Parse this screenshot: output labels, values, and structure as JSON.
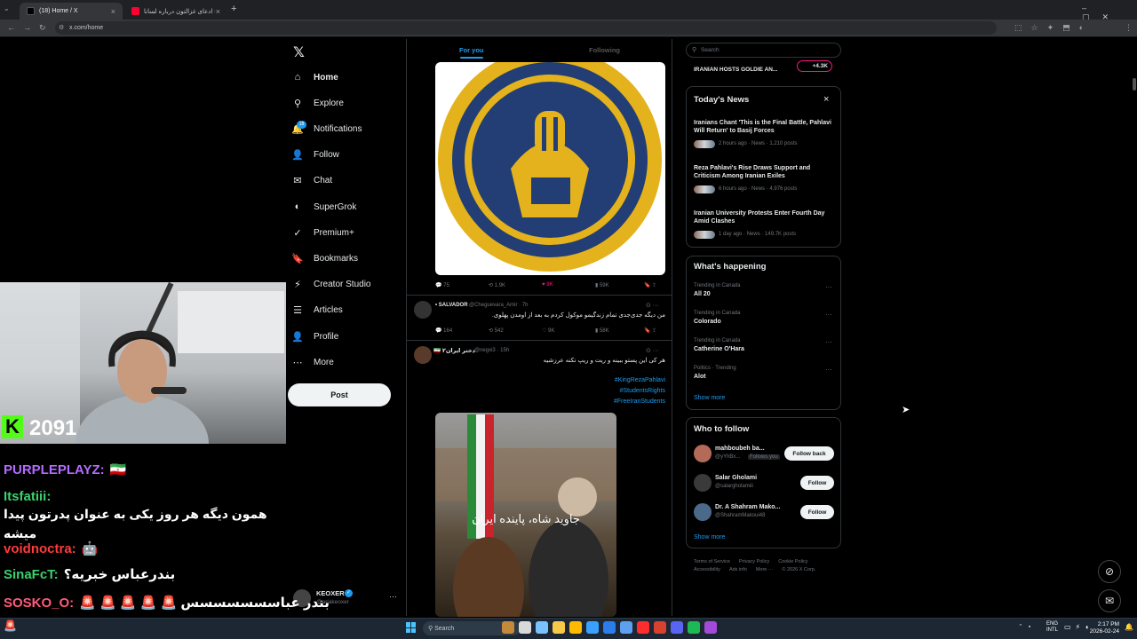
{
  "browser": {
    "tabs": [
      {
        "title": "(18) Home / X",
        "active": true
      },
      {
        "title": "ادعای غزالتون درباره لسانا (JM5)",
        "active": false
      }
    ],
    "new_tab": "+",
    "url": "x.com/home"
  },
  "sidebar": {
    "logo": "𝕏",
    "items": [
      {
        "label": "Home",
        "icon": "home-icon",
        "glyph": "⌂",
        "bold": true
      },
      {
        "label": "Explore",
        "icon": "search-icon",
        "glyph": "⚲"
      },
      {
        "label": "Notifications",
        "icon": "bell-icon",
        "glyph": "🔔",
        "badge": "18"
      },
      {
        "label": "Follow",
        "icon": "person-plus-icon",
        "glyph": "👤"
      },
      {
        "label": "Chat",
        "icon": "mail-icon",
        "glyph": "✉"
      },
      {
        "label": "SuperGrok",
        "icon": "grok-icon",
        "glyph": "◐"
      },
      {
        "label": "Premium+",
        "icon": "premium-icon",
        "glyph": "✓"
      },
      {
        "label": "Bookmarks",
        "icon": "bookmark-icon",
        "glyph": "🔖"
      },
      {
        "label": "Creator Studio",
        "icon": "creator-icon",
        "glyph": "⚡"
      },
      {
        "label": "Articles",
        "icon": "articles-icon",
        "glyph": "☰"
      },
      {
        "label": "Profile",
        "icon": "profile-icon",
        "glyph": "👤"
      },
      {
        "label": "More",
        "icon": "more-icon",
        "glyph": "⋯"
      }
    ],
    "post_button": "Post",
    "account": {
      "name": "KEOXER",
      "handle": "@ariakeoxer"
    }
  },
  "feed": {
    "tabs": [
      "For you",
      "Following"
    ],
    "tweet1_stats": {
      "replies": "75",
      "reposts": "1.9K",
      "likes": "9K",
      "views": "59K"
    },
    "tweet2": {
      "name": "• SALVADOR",
      "handle": "@Cheguevara_Amir · 7h",
      "text": "من دیگه جدی‌جدی تمام زندگیمو موکول کردم به بعد از اومدن پهلوی.",
      "stats": {
        "replies": "164",
        "reposts": "542",
        "likes": "9K",
        "views": "58K"
      }
    },
    "tweet3": {
      "name": "دختر ایران۲ 🇮🇷",
      "handle": "@negxi3 · 15h",
      "text": "هر کی این پستو ببینه و ریت و ریپ نکنه عرزشیه",
      "hashtags": [
        "#KingRezaPahlavi",
        "#StudentsRights",
        "#FreeIranStudents"
      ],
      "image_caption": "جاوید شاه، پاینده ایران"
    }
  },
  "right": {
    "search_placeholder": "Search",
    "live_banner": {
      "text": "IRANIAN HOSTS GOLDIE AN...",
      "count": "+4.3K"
    },
    "todays_news": {
      "title": "Today's News",
      "close": "×",
      "items": [
        {
          "headline": "Iranians Chant 'This is the Final Battle, Pahlavi Will Return' to Basij Forces",
          "meta": "2 hours ago · News · 1,210 posts"
        },
        {
          "headline": "Reza Pahlavi's Rise Draws Support and Criticism Among Iranian Exiles",
          "meta": "6 hours ago · News · 4,976 posts"
        },
        {
          "headline": "Iranian University Protests Enter Fourth Day Amid Clashes",
          "meta": "1 day ago · News · 149.7K posts"
        }
      ]
    },
    "whats_happening": {
      "title": "What's happening",
      "items": [
        {
          "context": "Trending in Canada",
          "name": "All 20"
        },
        {
          "context": "Trending in Canada",
          "name": "Colorado"
        },
        {
          "context": "Trending in Canada",
          "name": "Catherine O'Hara"
        },
        {
          "context": "Politics · Trending",
          "name": "Alot"
        }
      ],
      "show_more": "Show more"
    },
    "who_to_follow": {
      "title": "Who to follow",
      "items": [
        {
          "name": "mahboubeh ba...",
          "handle": "@yYhBx...",
          "follows_you": "Follows you",
          "button": "Follow back"
        },
        {
          "name": "Salar Gholami",
          "handle": "@salargholamiii",
          "button": "Follow"
        },
        {
          "name": "Dr. A Shahram Mako...",
          "handle": "@ShahramMakoui48",
          "button": "Follow"
        }
      ],
      "show_more": "Show more"
    },
    "footer": [
      "Terms of Service",
      "Privacy Policy",
      "Cookie Policy",
      "Accessibility",
      "Ads info",
      "More ···",
      "© 2026 X Corp."
    ]
  },
  "stream": {
    "kick_count": "2091",
    "chat": [
      {
        "name": "PURPLEPLAYZ:",
        "msg": "🇮🇷",
        "color": "#b46bff"
      },
      {
        "name": "Itsfatiii:",
        "msg": "همون دیگه هر روز یکی به عنوان پدرتون پیدا میشه",
        "color": "#3bd16f"
      },
      {
        "name": "voidnoctra:",
        "msg": "🤖",
        "color": "#ff3b3b"
      },
      {
        "name": "SinaFcT:",
        "msg": "بندرعباس خبریه؟",
        "color": "#3bd16f"
      },
      {
        "name": "SOSKO_O:",
        "msg": "بندر عباسسسسسسس 🚨 🚨 🚨 🚨 🚨",
        "color": "#ff5a7a"
      }
    ]
  },
  "taskbar": {
    "search": "Search",
    "lang": "ENG",
    "lang_sub": "INTL",
    "time": "2:17 PM",
    "date": "2026-02-24"
  },
  "colors": {
    "accent": "#1d9bf0",
    "like": "#f91880",
    "kick_green": "#53fc18"
  }
}
